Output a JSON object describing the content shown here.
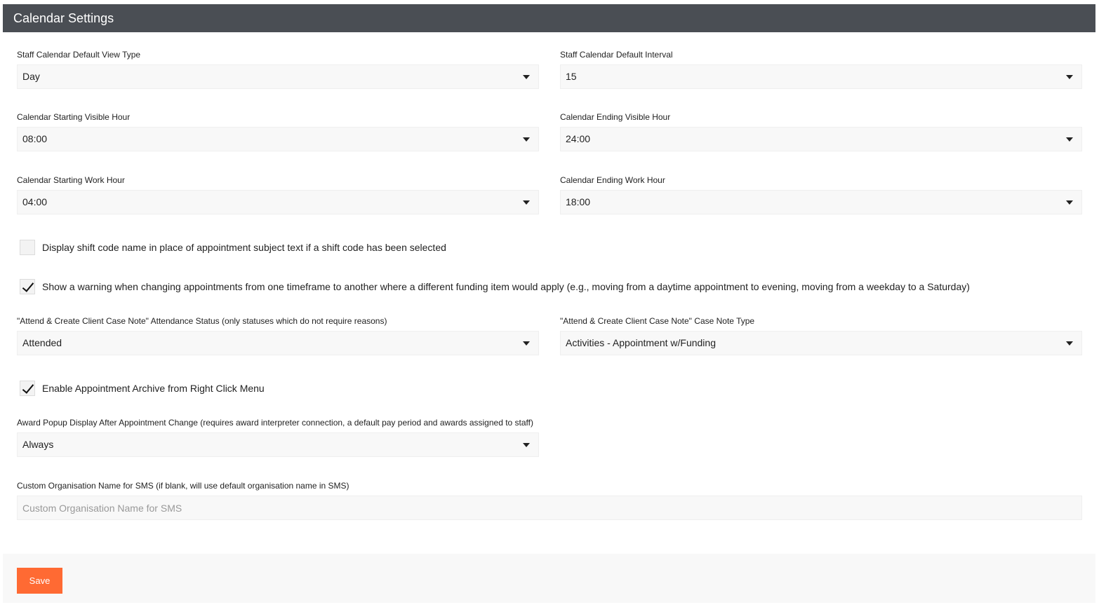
{
  "header": {
    "title": "Calendar Settings"
  },
  "fields": {
    "default_view_type": {
      "label": "Staff Calendar Default View Type",
      "value": "Day"
    },
    "default_interval": {
      "label": "Staff Calendar Default Interval",
      "value": "15"
    },
    "starting_visible_hour": {
      "label": "Calendar Starting Visible Hour",
      "value": "08:00"
    },
    "ending_visible_hour": {
      "label": "Calendar Ending Visible Hour",
      "value": "24:00"
    },
    "starting_work_hour": {
      "label": "Calendar Starting Work Hour",
      "value": "04:00"
    },
    "ending_work_hour": {
      "label": "Calendar Ending Work Hour",
      "value": "18:00"
    },
    "attendance_status": {
      "label": "\"Attend & Create Client Case Note\" Attendance Status (only statuses which do not require reasons)",
      "value": "Attended"
    },
    "case_note_type": {
      "label": "\"Attend & Create Client Case Note\" Case Note Type",
      "value": "Activities - Appointment w/Funding"
    },
    "award_popup": {
      "label": "Award Popup Display After Appointment Change (requires award interpreter connection, a default pay period and awards assigned to staff)",
      "value": "Always"
    },
    "custom_org_name": {
      "label": "Custom Organisation Name for SMS (if blank, will use default organisation name in SMS)",
      "value": "",
      "placeholder": "Custom Organisation Name for SMS"
    }
  },
  "checkboxes": {
    "shift_code_name": {
      "label": "Display shift code name in place of appointment subject text if a shift code has been selected",
      "checked": false
    },
    "funding_warning": {
      "label": "Show a warning when changing appointments from one timeframe to another where a different funding item would apply (e.g., moving from a daytime appointment to evening, moving from a weekday to a Saturday)",
      "checked": true
    },
    "archive_right_click": {
      "label": "Enable Appointment Archive from Right Click Menu",
      "checked": true
    }
  },
  "footer": {
    "save_label": "Save"
  },
  "colors": {
    "header_bg": "#4a4e54",
    "accent": "#ff6a33",
    "field_bg": "#f8f8f8"
  },
  "icons": {
    "dropdown": "chevron-down-icon",
    "check": "checkmark-icon"
  }
}
